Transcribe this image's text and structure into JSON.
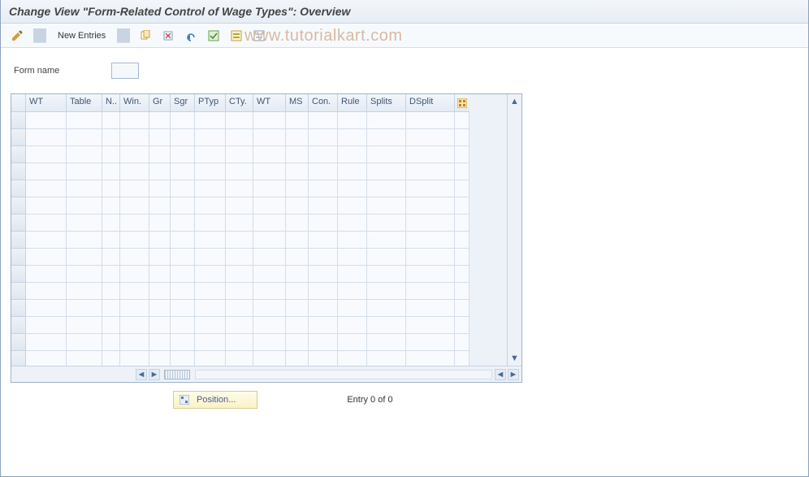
{
  "title": "Change View \"Form-Related Control of Wage Types\": Overview",
  "toolbar": {
    "new_entries_label": "New Entries"
  },
  "watermark": "www.tutorialkart.com",
  "field": {
    "form_name_label": "Form name",
    "form_name_value": ""
  },
  "table": {
    "columns": [
      "WT",
      "Table",
      "N..",
      "Win.",
      "Gr",
      "Sgr",
      "PTyp",
      "CTy.",
      "WT",
      "MS",
      "Con.",
      "Rule",
      "Splits",
      "DSplit"
    ],
    "col_classes": [
      "w-wt1",
      "w-table",
      "w-n",
      "w-win",
      "w-gr",
      "w-sgr",
      "w-ptyp",
      "w-cty",
      "w-wt2",
      "w-ms",
      "w-con",
      "w-rule",
      "w-splits",
      "w-dsplit"
    ],
    "rows": 15
  },
  "footer": {
    "position_label": "Position...",
    "entry_text": "Entry 0 of 0"
  }
}
